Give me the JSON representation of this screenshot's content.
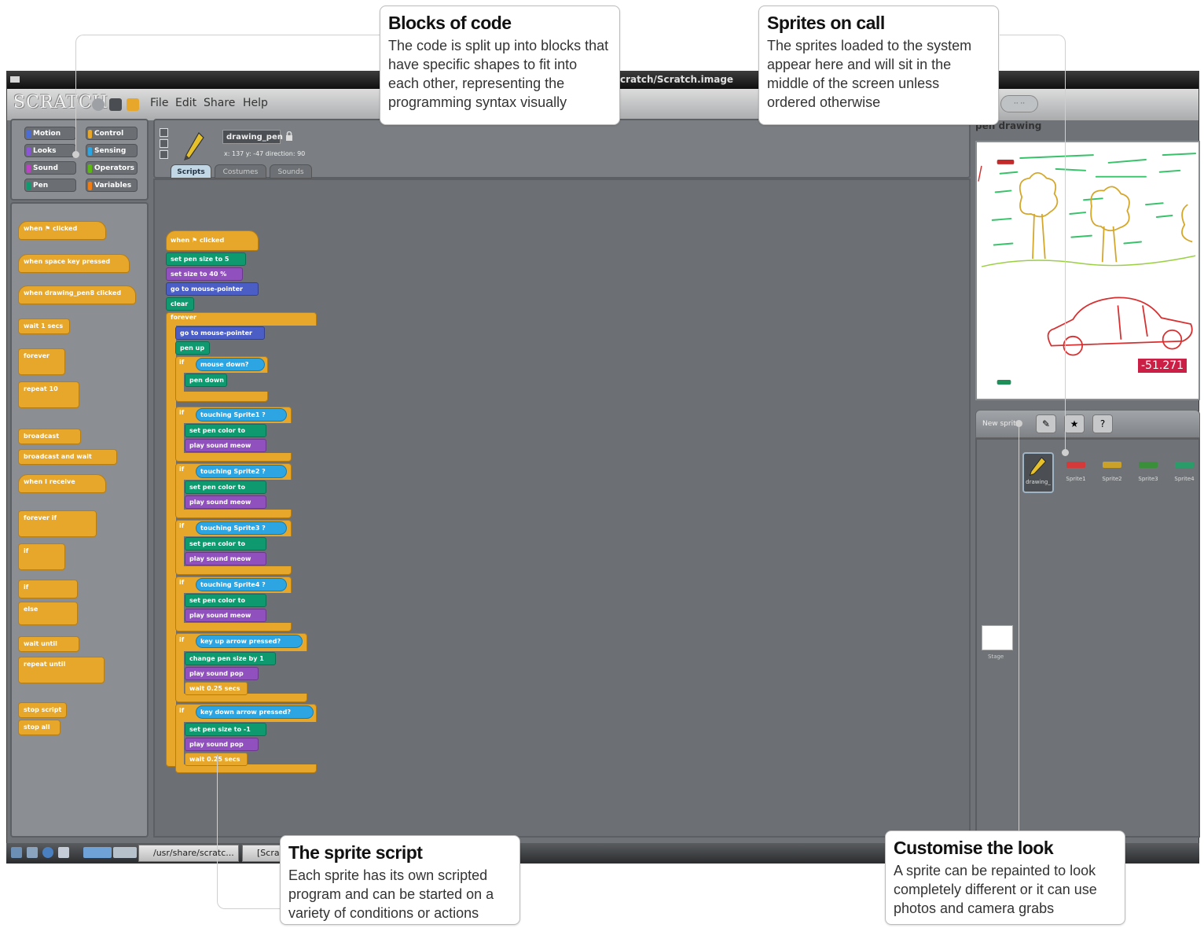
{
  "window": {
    "title": "cratch/Scratch.image"
  },
  "menubar": {
    "logo": "SCRATCH",
    "items": [
      "File",
      "Edit",
      "Share",
      "Help"
    ],
    "view_buttons": "·· ··"
  },
  "categories": [
    {
      "label": "Motion",
      "color": "#4a6cd4"
    },
    {
      "label": "Control",
      "color": "#e6a72b"
    },
    {
      "label": "Looks",
      "color": "#8a55d7"
    },
    {
      "label": "Sensing",
      "color": "#2ca5e2"
    },
    {
      "label": "Sound",
      "color": "#bb42c3"
    },
    {
      "label": "Operators",
      "color": "#5cb712"
    },
    {
      "label": "Pen",
      "color": "#0e9a6e"
    },
    {
      "label": "Variables",
      "color": "#ee7d16"
    }
  ],
  "palette_blocks": [
    "when ⚑ clicked",
    "when space key pressed",
    "when drawing_pen8 clicked",
    "wait 1 secs",
    "forever",
    "repeat 10",
    "broadcast",
    "broadcast and wait",
    "when I receive",
    "forever if",
    "if",
    "if",
    "else",
    "wait until",
    "repeat until",
    "stop script",
    "stop all"
  ],
  "sprite": {
    "name": "drawing_pen",
    "coords": "x: 137  y: -47  direction: 90",
    "tabs": [
      "Scripts",
      "Costumes",
      "Sounds"
    ]
  },
  "script": {
    "hat": "when ⚑ clicked",
    "setup": [
      {
        "text": "set pen size to 5",
        "kind": "g"
      },
      {
        "text": "set size to 40 %",
        "kind": "p"
      },
      {
        "text": "go to mouse-pointer",
        "kind": "b"
      },
      {
        "text": "clear",
        "kind": "g"
      }
    ],
    "forever": "forever",
    "loop": [
      {
        "text": "go to mouse-pointer",
        "kind": "b"
      },
      {
        "text": "pen up",
        "kind": "g"
      }
    ],
    "conditions": [
      {
        "cond": "mouse down?",
        "body": [
          "pen down"
        ]
      },
      {
        "cond": "touching Sprite1 ?",
        "body": [
          "set pen color to",
          "play sound meow"
        ]
      },
      {
        "cond": "touching Sprite2 ?",
        "body": [
          "set pen color to",
          "play sound meow"
        ]
      },
      {
        "cond": "touching Sprite3 ?",
        "body": [
          "set pen color to",
          "play sound meow"
        ]
      },
      {
        "cond": "touching Sprite4 ?",
        "body": [
          "set pen color to",
          "play sound meow"
        ]
      },
      {
        "cond": "key up arrow pressed?",
        "body": [
          "change pen size by 1",
          "play sound pop",
          "wait 0.25 secs"
        ]
      },
      {
        "cond": "key down arrow pressed?",
        "body": [
          "set pen size to -1",
          "play sound pop",
          "wait 0.25 secs"
        ]
      }
    ],
    "if_label": "if"
  },
  "stage": {
    "title": "pen drawing"
  },
  "sprite_pane": {
    "new_sprite": "New sprite:",
    "coord_badge": "-51.271",
    "sprites": [
      {
        "label": "drawing_",
        "color": "#e6c12b"
      },
      {
        "label": "Sprite1",
        "color": "#d43a3a"
      },
      {
        "label": "Sprite2",
        "color": "#caa12b"
      },
      {
        "label": "Sprite3",
        "color": "#3a8f3a"
      },
      {
        "label": "Sprite4",
        "color": "#2a9c6a"
      }
    ],
    "stage_label": "Stage"
  },
  "taskbar": {
    "items": [
      "/usr/share/scratc...",
      "[Scra"
    ]
  },
  "callouts": {
    "blocks": {
      "title": "Blocks of code",
      "text": "The code is split up into blocks that have specific shapes to fit into each other, representing the programming syntax visually"
    },
    "sprites": {
      "title": "Sprites on call",
      "text": "The sprites loaded to the system appear here and will sit in the middle of the screen unless ordered otherwise"
    },
    "script": {
      "title": "The sprite script",
      "text": "Each sprite has its own scripted program and can be started on a variety of conditions or actions"
    },
    "look": {
      "title": "Customise the look",
      "text": "A sprite can be repainted to look completely different or it can use photos and camera grabs"
    }
  }
}
